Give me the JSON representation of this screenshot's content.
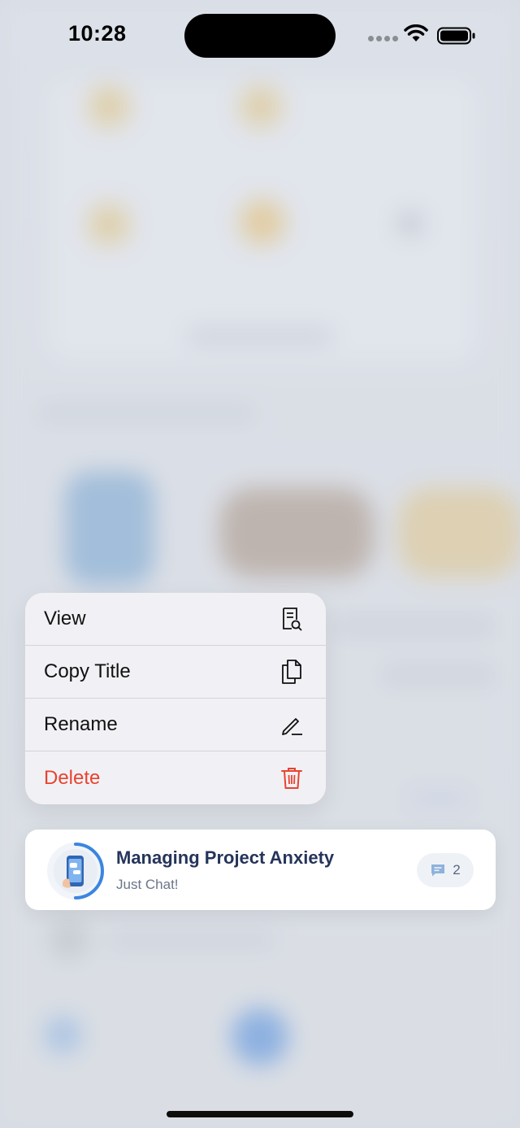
{
  "status_bar": {
    "time": "10:28"
  },
  "context_menu": {
    "items": [
      {
        "label": "View",
        "icon": "document-search-icon"
      },
      {
        "label": "Copy Title",
        "icon": "copy-icon"
      },
      {
        "label": "Rename",
        "icon": "pencil-icon"
      },
      {
        "label": "Delete",
        "icon": "trash-icon"
      }
    ]
  },
  "chat_card": {
    "title": "Managing Project Anxiety",
    "subtitle": "Just Chat!",
    "message_count": "2",
    "avatar": "phone-assistant-avatar"
  },
  "colors": {
    "danger": "#e8432f",
    "title": "#25345a",
    "accent": "#3a86e0"
  }
}
